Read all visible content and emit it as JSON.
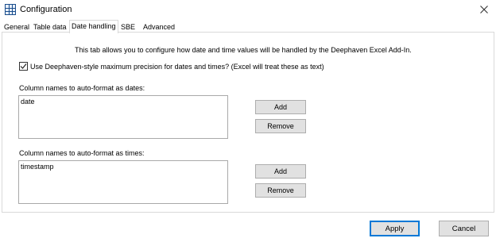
{
  "window": {
    "title": "Configuration",
    "app_icon": "grid-icon",
    "close_icon": "close-icon"
  },
  "tabs": [
    {
      "label": "General",
      "active": false
    },
    {
      "label": "Table data",
      "active": false
    },
    {
      "label": "Date handling",
      "active": true
    },
    {
      "label": "SBE",
      "active": false
    },
    {
      "label": "Advanced",
      "active": false
    }
  ],
  "date_handling": {
    "description": "This tab allows you to configure how date and time values will be handled by the Deephaven Excel Add-In.",
    "max_precision": {
      "checked": true,
      "label": "Use Deephaven-style maximum precision for dates and times? (Excel will treat these as text)"
    },
    "dates": {
      "label": "Column names to auto-format as dates:",
      "items": [
        "date"
      ],
      "add_label": "Add",
      "remove_label": "Remove"
    },
    "times": {
      "label": "Column names to auto-format as times:",
      "items": [
        "timestamp"
      ],
      "add_label": "Add",
      "remove_label": "Remove"
    }
  },
  "footer": {
    "apply_label": "Apply",
    "cancel_label": "Cancel"
  }
}
